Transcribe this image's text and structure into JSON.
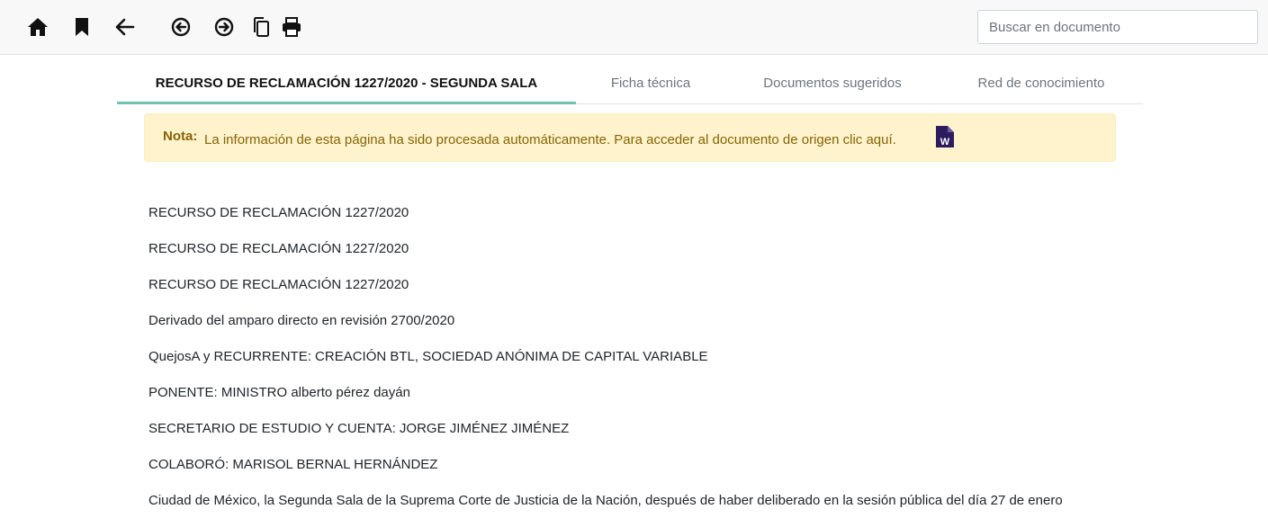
{
  "toolbar": {
    "icons": [
      "home-icon",
      "bookmark-icon",
      "arrow-left-icon",
      "circle-arrow-left-icon",
      "circle-arrow-right-icon",
      "copy-icon",
      "print-icon"
    ],
    "search_placeholder": "Buscar en documento"
  },
  "tabs": [
    {
      "label": "RECURSO DE RECLAMACIÓN 1227/2020 - SEGUNDA SALA",
      "active": true
    },
    {
      "label": "Ficha técnica",
      "active": false
    },
    {
      "label": "Documentos sugeridos",
      "active": false
    },
    {
      "label": "Red de conocimiento",
      "active": false
    }
  ],
  "note": {
    "label": "Nota:",
    "text": "La información de esta página ha sido procesada automáticamente. Para acceder al documento de origen clic aquí.",
    "doc_icon": "word-document-icon"
  },
  "document": {
    "lines": [
      "RECURSO DE RECLAMACIÓN 1227/2020",
      "RECURSO DE RECLAMACIÓN 1227/2020",
      "RECURSO DE RECLAMACIÓN 1227/2020",
      "Derivado del amparo directo en revisión 2700/2020",
      "QuejosA y RECURRENTE: CREACIÓN BTL, SOCIEDAD ANÓNIMA DE CAPITAL VARIABLE",
      "PONENTE: MINISTRO alberto pérez dayán",
      "SECRETARIO DE ESTUDIO Y CUENTA: JORGE JIMÉNEZ JIMÉNEZ",
      "COLABORÓ: MARISOL BERNAL HERNÁNDEZ",
      "Ciudad de México, la Segunda Sala de la Suprema Corte de Justicia de la Nación, después de haber deliberado en la sesión pública del día 27 de enero"
    ]
  },
  "colors": {
    "accent": "#6fc2b0",
    "note_bg": "#fff3cd",
    "note_text": "#856404",
    "word_icon": "#2d1b5e"
  }
}
